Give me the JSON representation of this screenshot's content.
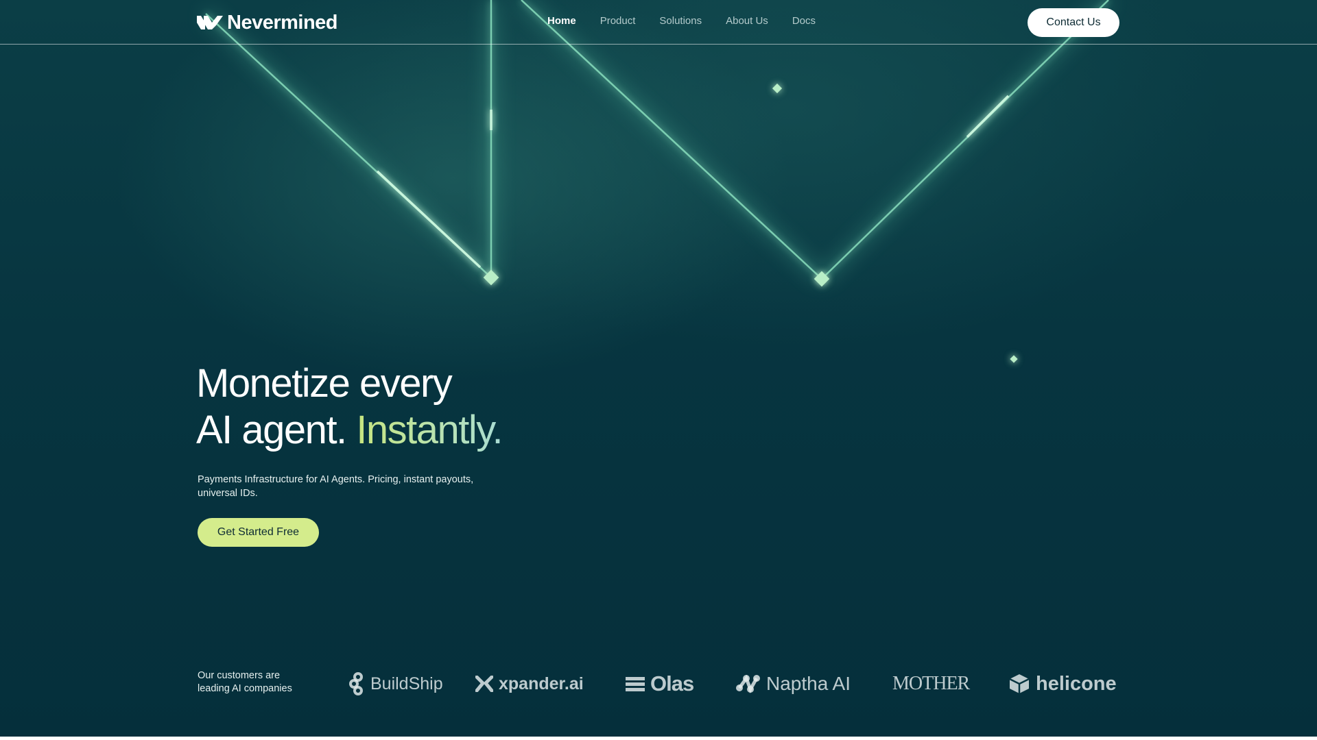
{
  "brand": {
    "name": "Nevermined",
    "logo_icon": "nevermined-logo-icon"
  },
  "nav": {
    "links": [
      {
        "label": "Home",
        "active": true
      },
      {
        "label": "Product",
        "active": false
      },
      {
        "label": "Solutions",
        "active": false
      },
      {
        "label": "About Us",
        "active": false
      },
      {
        "label": "Docs",
        "active": false
      }
    ],
    "contact_label": "Contact Us"
  },
  "hero": {
    "headline_line1": "Monetize every",
    "headline_line2": "AI agent.",
    "headline_accent": "Instantly.",
    "subtext": "Payments Infrastructure for AI Agents. Pricing, instant payouts, universal IDs.",
    "cta_label": "Get Started Free"
  },
  "customers": {
    "label": "Our customers are leading AI companies",
    "logos": [
      {
        "name": "BuildShip",
        "icon": "buildship-logo-icon"
      },
      {
        "name": "xpander.ai",
        "icon": "xpander-logo-icon"
      },
      {
        "name": "Olas",
        "icon": "olas-logo-icon"
      },
      {
        "name": "Naptha AI",
        "icon": "naptha-logo-icon"
      },
      {
        "name": "MOTHER",
        "icon": "mother-wordmark"
      },
      {
        "name": "helicone",
        "icon": "helicone-logo-icon"
      }
    ]
  },
  "colors": {
    "background": "#073540",
    "accent_green": "#d4ec8c",
    "beam": "#7fd6b4",
    "text": "#ffffff"
  }
}
